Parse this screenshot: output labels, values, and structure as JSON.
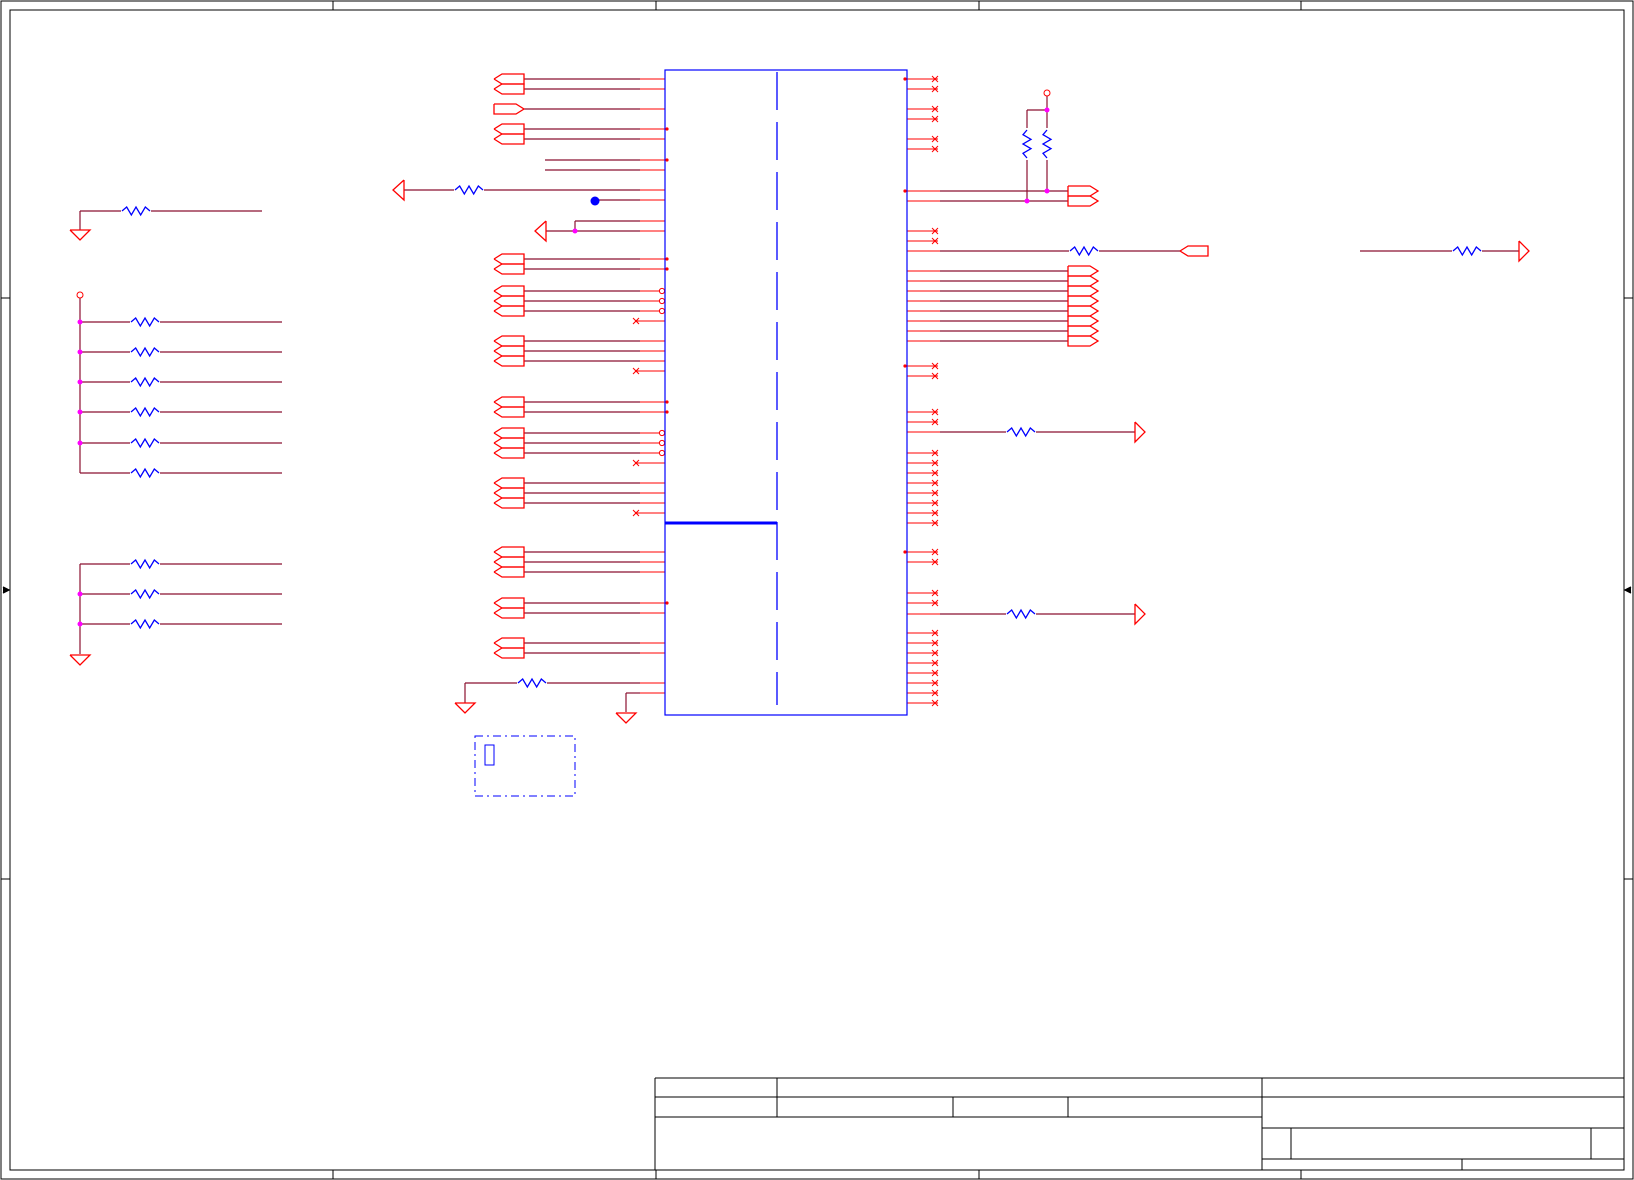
{
  "colors": {
    "background": "#ffffff",
    "frame": "#000000",
    "wire": "#8b1030",
    "pin": "#ff0000",
    "part": "#0000ff",
    "junction": "#ff00ff"
  },
  "sheet": {
    "title": "",
    "document_number": "",
    "revision": "",
    "size": "",
    "date": "",
    "sheet_label": ""
  },
  "icons": {
    "ground": "ground-icon",
    "resistor": "resistor-icon",
    "power": "power-icon",
    "net_port": "net-port-icon",
    "no_connect": "no-connect-icon"
  }
}
